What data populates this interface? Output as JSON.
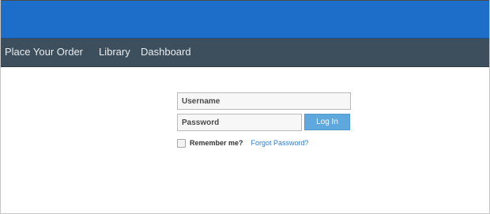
{
  "nav": {
    "items": [
      {
        "label": "Place Your Order"
      },
      {
        "label": "Library"
      },
      {
        "label": "Dashboard"
      }
    ]
  },
  "login": {
    "username_placeholder": "Username",
    "username_value": "",
    "password_placeholder": "Password",
    "password_value": "",
    "submit_label": "Log In",
    "remember_label": "Remember me?",
    "forgot_label": "Forgot Password?"
  },
  "colors": {
    "topbar": "#1c6ec8",
    "navbar": "#3d4f5c",
    "button": "#5ea8de",
    "link": "#2f7dd1"
  }
}
